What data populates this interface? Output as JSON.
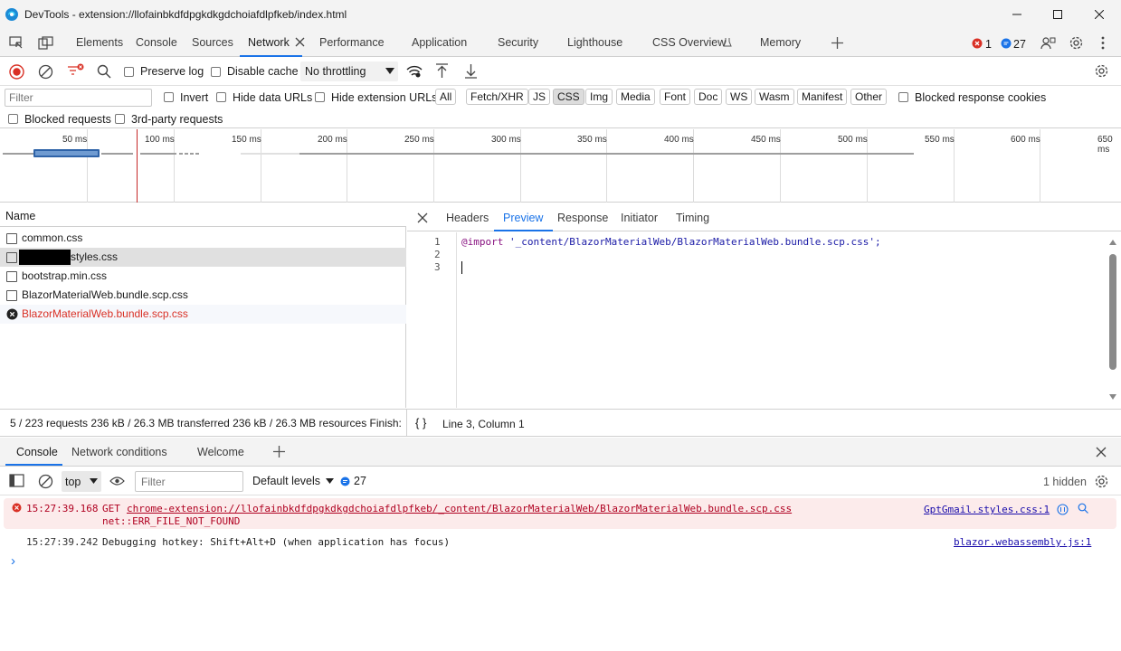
{
  "window": {
    "title": "DevTools - extension://llofainbkdfdpgkdkgdchoiafdlpfkeb/index.html",
    "controls": [
      "minimize",
      "maximize",
      "close"
    ]
  },
  "main_tabs": [
    {
      "label": "Elements"
    },
    {
      "label": "Console"
    },
    {
      "label": "Sources"
    },
    {
      "label": "Network",
      "active": true
    },
    {
      "label": "Performance"
    },
    {
      "label": "Application"
    },
    {
      "label": "Security"
    },
    {
      "label": "Lighthouse"
    },
    {
      "label": "CSS Overview"
    },
    {
      "label": "Memory"
    }
  ],
  "counters": {
    "errors": "1",
    "messages": "27"
  },
  "network_toolbar": {
    "preserve_log": "Preserve log",
    "disable_cache": "Disable cache",
    "throttling": "No throttling"
  },
  "filter_bar": {
    "filter_placeholder": "Filter",
    "invert": "Invert",
    "hide_data_urls": "Hide data URLs",
    "hide_extension_urls": "Hide extension URLs",
    "types": [
      "All",
      "Fetch/XHR",
      "JS",
      "CSS",
      "Img",
      "Media",
      "Font",
      "Doc",
      "WS",
      "Wasm",
      "Manifest",
      "Other"
    ],
    "active_type": "CSS",
    "blocked_response_cookies": "Blocked response cookies",
    "blocked_requests": "Blocked requests",
    "third_party_requests": "3rd-party requests"
  },
  "overview": {
    "ticks": [
      "50 ms",
      "100 ms",
      "150 ms",
      "200 ms",
      "250 ms",
      "300 ms",
      "350 ms",
      "400 ms",
      "450 ms",
      "500 ms",
      "550 ms",
      "600 ms",
      "650 ms"
    ]
  },
  "request_list": {
    "header": "Name",
    "rows": [
      {
        "name": "common.css",
        "status": "ok"
      },
      {
        "name": "styles.css",
        "status": "ok",
        "selected": true,
        "redacted_prefix": true
      },
      {
        "name": "bootstrap.min.css",
        "status": "ok"
      },
      {
        "name": "BlazorMaterialWeb.bundle.scp.css",
        "status": "ok"
      },
      {
        "name": "BlazorMaterialWeb.bundle.scp.css",
        "status": "error"
      }
    ]
  },
  "preview": {
    "tabs": [
      {
        "label": "Headers"
      },
      {
        "label": "Preview",
        "active": true
      },
      {
        "label": "Response"
      },
      {
        "label": "Initiator"
      },
      {
        "label": "Timing"
      }
    ],
    "lines": [
      {
        "num": "1",
        "keyword": "@import",
        "text": " '_content/BlazorMaterialWeb/BlazorMaterialWeb.bundle.scp.css';"
      },
      {
        "num": "2",
        "keyword": "",
        "text": ""
      },
      {
        "num": "3",
        "keyword": "",
        "text": ""
      }
    ],
    "cursor": "Line 3, Column 1",
    "pretty_print": "{ }"
  },
  "status_bar": {
    "text": "5 / 223 requests  236 kB / 26.3 MB transferred  236 kB / 26.3 MB resources  Finish:"
  },
  "drawer": {
    "tabs": [
      {
        "label": "Console",
        "active": true
      },
      {
        "label": "Network conditions"
      },
      {
        "label": "Welcome"
      }
    ],
    "toolbar": {
      "context": "top",
      "filter_placeholder": "Filter",
      "levels": "Default levels",
      "message_count": "27",
      "hidden": "1 hidden"
    },
    "messages": [
      {
        "type": "error",
        "time": "15:27:39.168",
        "method": "GET",
        "url": "chrome-extension://llofainbkdfdpgkdkgdchoiafdlpfkeb/_content/BlazorMaterialWeb/BlazorMaterialWeb.bundle.scp.css",
        "detail": "net::ERR_FILE_NOT_FOUND",
        "source": "GptGmail.styles.css:1"
      },
      {
        "type": "info",
        "time": "15:27:39.242",
        "text": "Debugging hotkey: Shift+Alt+D (when application has focus)",
        "source": "blazor.webassembly.js:1"
      }
    ],
    "prompt": "›"
  },
  "colors": {
    "accent": "#1a73e8",
    "error": "#d93025",
    "error_bg": "#fcebeb",
    "selected_row": "#e0e0e0"
  }
}
